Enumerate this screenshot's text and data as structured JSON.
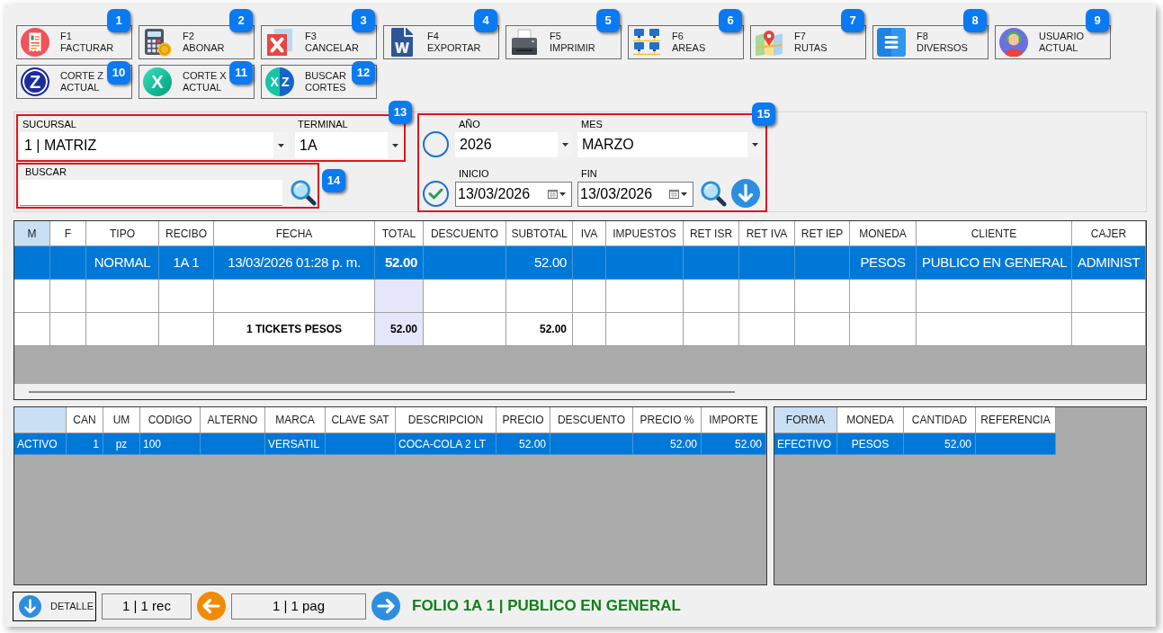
{
  "toolbar": [
    {
      "kind": "invoice",
      "lines": [
        "F1",
        "FACTURAR"
      ],
      "callout": "1"
    },
    {
      "kind": "payment",
      "lines": [
        "F2",
        "ABONAR"
      ],
      "callout": "2"
    },
    {
      "kind": "cancel",
      "lines": [
        "F3",
        "CANCELAR"
      ],
      "callout": "3"
    },
    {
      "kind": "export",
      "lines": [
        "F4",
        "EXPORTAR"
      ],
      "callout": "4"
    },
    {
      "kind": "print",
      "lines": [
        "F5",
        "IMPRIMIR"
      ],
      "callout": "5"
    },
    {
      "kind": "network",
      "lines": [
        "F6",
        "AREAS"
      ],
      "callout": "6"
    },
    {
      "kind": "map",
      "lines": [
        "F7",
        "RUTAS"
      ],
      "callout": "7"
    },
    {
      "kind": "menu",
      "lines": [
        "F8",
        "DIVERSOS"
      ],
      "callout": "8"
    },
    {
      "kind": "user",
      "lines": [
        "USUARIO",
        "ACTUAL"
      ],
      "callout": "9"
    },
    {
      "kind": "zcut",
      "letters": [
        "Z"
      ],
      "lines": [
        "CORTE Z",
        "ACTUAL"
      ],
      "callout": "10"
    },
    {
      "kind": "xcut",
      "letters": [
        "X"
      ],
      "lines": [
        "CORTE X",
        "ACTUAL"
      ],
      "callout": "11"
    },
    {
      "kind": "findcuts",
      "letters": [
        "X",
        "Z"
      ],
      "lines": [
        "BUSCAR",
        "CORTES"
      ],
      "callout": "12"
    }
  ],
  "location": {
    "callout": "13",
    "fields": [
      {
        "label": "SUCURSAL",
        "value": "1 | MATRIZ"
      },
      {
        "label": "TERMINAL",
        "value": "1A"
      }
    ]
  },
  "search": {
    "callout": "14",
    "label": "BUSCAR"
  },
  "period": {
    "callout": "15",
    "modes": [
      {
        "selected": false,
        "fields": [
          {
            "kind": "combo",
            "label": "AÑO",
            "value": "2026"
          },
          {
            "kind": "combo",
            "label": "MES",
            "value": "MARZO"
          }
        ]
      },
      {
        "selected": true,
        "fields": [
          {
            "kind": "date",
            "label": "INICIO",
            "value": "13/03/2026"
          },
          {
            "kind": "date",
            "label": "FIN",
            "value": "13/03/2026"
          }
        ]
      }
    ]
  },
  "tickets": {
    "columns": [
      {
        "label": "M",
        "selected": true,
        "highlighted": false
      },
      {
        "label": "F",
        "selected": false,
        "highlighted": false
      },
      {
        "label": "TIPO",
        "selected": false,
        "highlighted": false
      },
      {
        "label": "RECIBO",
        "selected": false,
        "highlighted": false
      },
      {
        "label": "FECHA",
        "selected": false,
        "highlighted": false
      },
      {
        "label": "TOTAL",
        "selected": false,
        "highlighted": true
      },
      {
        "label": "DESCUENTO",
        "selected": false,
        "highlighted": false
      },
      {
        "label": "SUBTOTAL",
        "selected": false,
        "highlighted": false
      },
      {
        "label": "IVA",
        "selected": false,
        "highlighted": false
      },
      {
        "label": "IMPUESTOS",
        "selected": false,
        "highlighted": false
      },
      {
        "label": "RET ISR",
        "selected": false,
        "highlighted": false
      },
      {
        "label": "RET IVA",
        "selected": false,
        "highlighted": false
      },
      {
        "label": "RET IEP",
        "selected": false,
        "highlighted": false
      },
      {
        "label": "MONEDA",
        "selected": false,
        "highlighted": false
      },
      {
        "label": "CLIENTE",
        "selected": false,
        "highlighted": false
      },
      {
        "label": "CAJER",
        "selected": false,
        "highlighted": false
      }
    ],
    "rows": [
      {
        "kind": "data",
        "selected": true,
        "cells": [
          null,
          null,
          "NORMAL",
          "1A 1",
          "13/03/2026 01:28 p. m.",
          "52.00",
          null,
          "52.00",
          null,
          null,
          null,
          null,
          null,
          "PESOS",
          "PUBLICO EN GENERAL",
          "ADMINIST"
        ]
      },
      {
        "kind": "blank",
        "selected": false
      },
      {
        "kind": "total",
        "selected": false,
        "cells": [
          null,
          null,
          null,
          null,
          "1 TICKETS PESOS",
          "52.00",
          null,
          "52.00",
          null,
          null,
          null,
          null,
          null,
          null,
          null,
          null
        ]
      }
    ]
  },
  "items": {
    "columns": [
      {
        "selected": true
      },
      {
        "label": "CAN",
        "selected": false
      },
      {
        "label": "UM",
        "selected": false
      },
      {
        "label": "CODIGO",
        "selected": false
      },
      {
        "label": "ALTERNO",
        "selected": false
      },
      {
        "label": "MARCA",
        "selected": false
      },
      {
        "label": "CLAVE SAT",
        "selected": false
      },
      {
        "label": "DESCRIPCION",
        "selected": false
      },
      {
        "label": "PRECIO",
        "selected": false
      },
      {
        "label": "DESCUENTO",
        "selected": false
      },
      {
        "label": "PRECIO %",
        "selected": false
      },
      {
        "label": "IMPORTE",
        "selected": false
      }
    ],
    "rows": [
      {
        "selected": true,
        "cells": [
          "ACTIVO",
          "1",
          "pz",
          "100",
          null,
          "VERSATIL",
          null,
          "COCA-COLA 2 LT",
          "52.00",
          null,
          "52.00",
          "52.00"
        ]
      }
    ]
  },
  "payments": {
    "columns": [
      {
        "label": "FORMA",
        "selected": true
      },
      {
        "label": "MONEDA",
        "selected": false
      },
      {
        "label": "CANTIDAD",
        "selected": false
      },
      {
        "label": "REFERENCIA",
        "selected": false
      }
    ],
    "rows": [
      {
        "selected": true,
        "cells": [
          "EFECTIVO",
          "PESOS",
          "52.00",
          null
        ]
      }
    ]
  },
  "footer": {
    "detail_button": "DETALLE",
    "records": "1 | 1 rec",
    "pages": "1 | 1 pag",
    "status": "FOLIO 1A 1 | PUBLICO EN GENERAL"
  }
}
